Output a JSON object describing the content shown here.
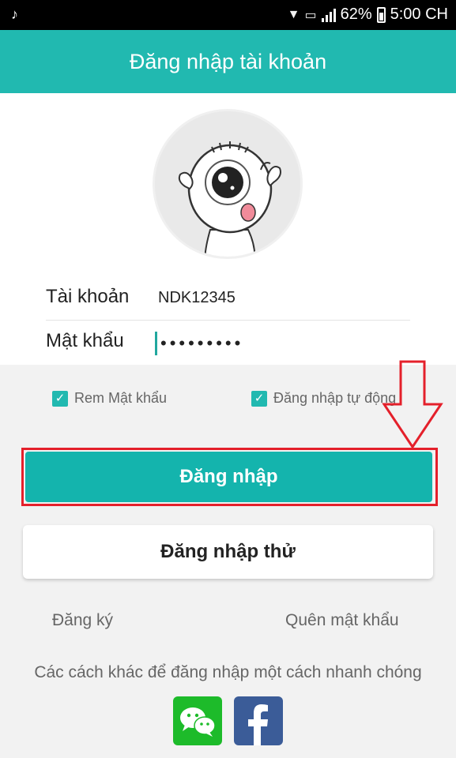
{
  "status_bar": {
    "left_icon": "tiktok-icon",
    "battery": "62%",
    "time": "5:00 CH"
  },
  "header": {
    "title": "Đăng nhập tài khoản"
  },
  "form": {
    "account_label": "Tài khoản",
    "account_value": "NDK12345",
    "password_label": "Mật khẩu",
    "password_value": "•••••••••"
  },
  "options": {
    "remember_label": "Rem Mật khẩu",
    "remember_checked": true,
    "auto_login_label": "Đăng nhập tự động",
    "auto_login_checked": true
  },
  "buttons": {
    "login": "Đăng nhập",
    "trial_login": "Đăng nhập thử"
  },
  "links": {
    "register": "Đăng ký",
    "forgot_password": "Quên mật khẩu"
  },
  "other_methods": {
    "text": "Các cách khác để đăng nhập một cách nhanh chóng",
    "items": [
      "wechat-icon",
      "facebook-icon"
    ]
  },
  "colors": {
    "accent": "#21b9b0",
    "annotation": "#e4202b",
    "wechat": "#1dbb2a",
    "facebook": "#3b5c98"
  }
}
